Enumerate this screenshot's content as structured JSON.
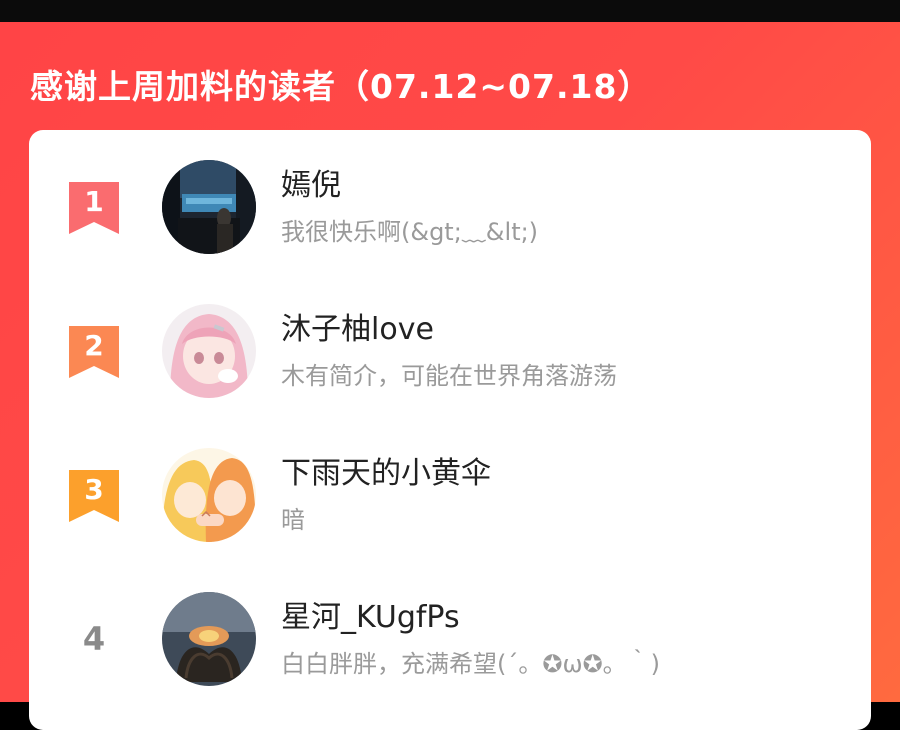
{
  "header": {
    "title": "感谢上周加料的读者（07.12~07.18）",
    "background_from": "#ff4446",
    "background_to": "#ff6a3f"
  },
  "readers": [
    {
      "rank": "1",
      "name": "嫣倪",
      "bio": "我很快乐啊(&gt;﹏&lt;)",
      "ribbon_color": "#fa6c6f",
      "avatar_icon": "avatar-city-night-icon"
    },
    {
      "rank": "2",
      "name": "沐子柚love",
      "bio": "木有简介，可能在世界角落游荡",
      "ribbon_color": "#fb8853",
      "avatar_icon": "avatar-anime-girl-icon"
    },
    {
      "rank": "3",
      "name": "下雨天的小黄伞",
      "bio": "暗",
      "ribbon_color": "#fca02c",
      "avatar_icon": "avatar-anime-couple-icon"
    },
    {
      "rank": "4",
      "name": "星河_KUgfPs",
      "bio": "白白胖胖，充满希望(´。✪ω✪。｀)",
      "ribbon_color": "",
      "avatar_icon": "avatar-heart-hands-icon"
    }
  ]
}
